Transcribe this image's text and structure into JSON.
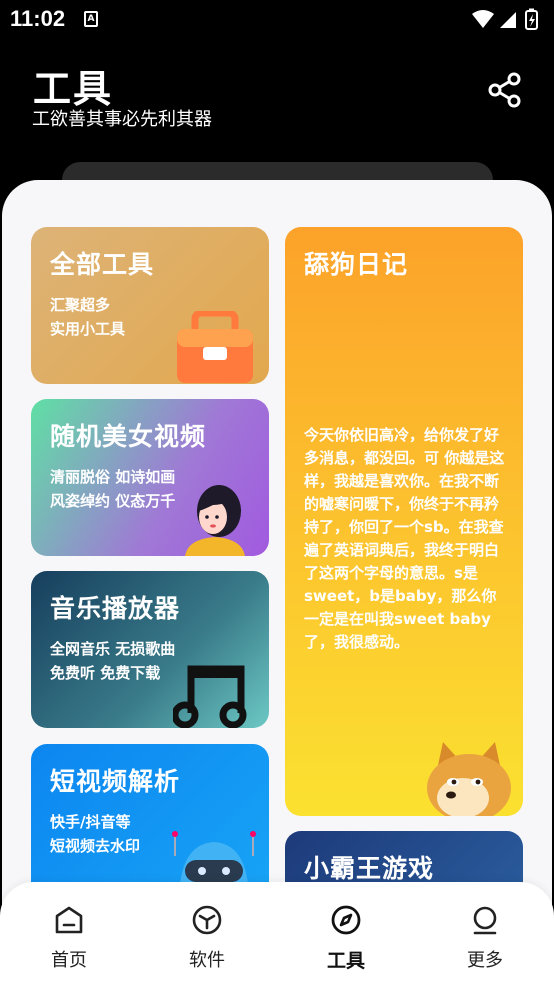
{
  "status_bar": {
    "time": "11:02",
    "sim_badge": "A"
  },
  "header": {
    "title": "工具",
    "subtitle": "工欲善其事必先利其器",
    "share_icon": "share-icon"
  },
  "cards": {
    "all_tools": {
      "title": "全部工具",
      "desc_line1": "汇聚超多",
      "desc_line2": "实用小工具",
      "icon": "toolbox-icon"
    },
    "random_video": {
      "title": "随机美女视频",
      "desc_line1": "清丽脱俗 如诗如画",
      "desc_line2": "风姿绰约 仪态万千",
      "icon": "woman-avatar-icon"
    },
    "music_player": {
      "title": "音乐播放器",
      "desc_line1": "全网音乐 无损歌曲",
      "desc_line2": "免费听 免费下载",
      "icon": "music-note-icon"
    },
    "short_video": {
      "title": "短视频解析",
      "desc_line1": "快手/抖音等",
      "desc_line2": "短视频去水印",
      "icon": "robot-icon"
    },
    "diary": {
      "title": "舔狗日记",
      "story": "今天你依旧高冷，给你发了好多消息，都没回。可 你越是这样，我越是喜欢你。在我不断的嘘寒问暖下，你终于不再矜持了，你回了一个sb。在我查遍了英语词典后，我终于明白了这两个字母的意思。s是sweet，b是baby，那么你一定是在叫我sweet baby了，我很感动。",
      "icon": "doge-icon"
    },
    "game": {
      "title": "小霸王游戏"
    }
  },
  "bottom_nav": {
    "items": [
      {
        "label": "首页",
        "icon": "home-icon"
      },
      {
        "label": "软件",
        "icon": "cube-icon"
      },
      {
        "label": "工具",
        "icon": "compass-icon",
        "active": true
      },
      {
        "label": "更多",
        "icon": "person-icon"
      }
    ]
  },
  "colors": {
    "background": "#000000",
    "panel": "#f7f7f9",
    "card_all_tools": "#e0ad60",
    "card_diary": "#fcb42c",
    "card_music": "#2f6a7c",
    "card_short_video": "#1296f3",
    "card_game": "#23487f"
  }
}
